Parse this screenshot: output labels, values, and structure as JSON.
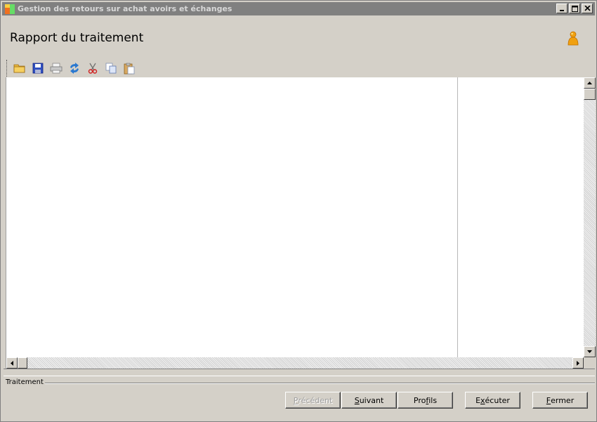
{
  "window": {
    "title": "Gestion des retours sur achat avoirs et échanges"
  },
  "header": {
    "title": "Rapport du traitement"
  },
  "toolbar": {
    "items": [
      {
        "icon": "open-folder-icon"
      },
      {
        "icon": "save-icon"
      },
      {
        "icon": "print-icon"
      },
      {
        "icon": "refresh-icon"
      },
      {
        "icon": "cut-icon"
      },
      {
        "icon": "copy-icon"
      },
      {
        "icon": "paste-icon"
      }
    ]
  },
  "status": {
    "label": "Traitement"
  },
  "buttons": {
    "previous": {
      "pre": "",
      "accel": "P",
      "post": "récédent",
      "enabled": false
    },
    "next": {
      "pre": "",
      "accel": "S",
      "post": "uivant",
      "enabled": true
    },
    "profiles": {
      "pre": "Pro",
      "accel": "f",
      "post": "ils",
      "enabled": true
    },
    "execute": {
      "pre": "E",
      "accel": "x",
      "post": "écuter",
      "enabled": true
    },
    "close": {
      "pre": "",
      "accel": "F",
      "post": "ermer",
      "enabled": true
    }
  },
  "colors": {
    "titlebar": "#808080",
    "face": "#d4d0c8",
    "content_bg": "#ffffff"
  }
}
